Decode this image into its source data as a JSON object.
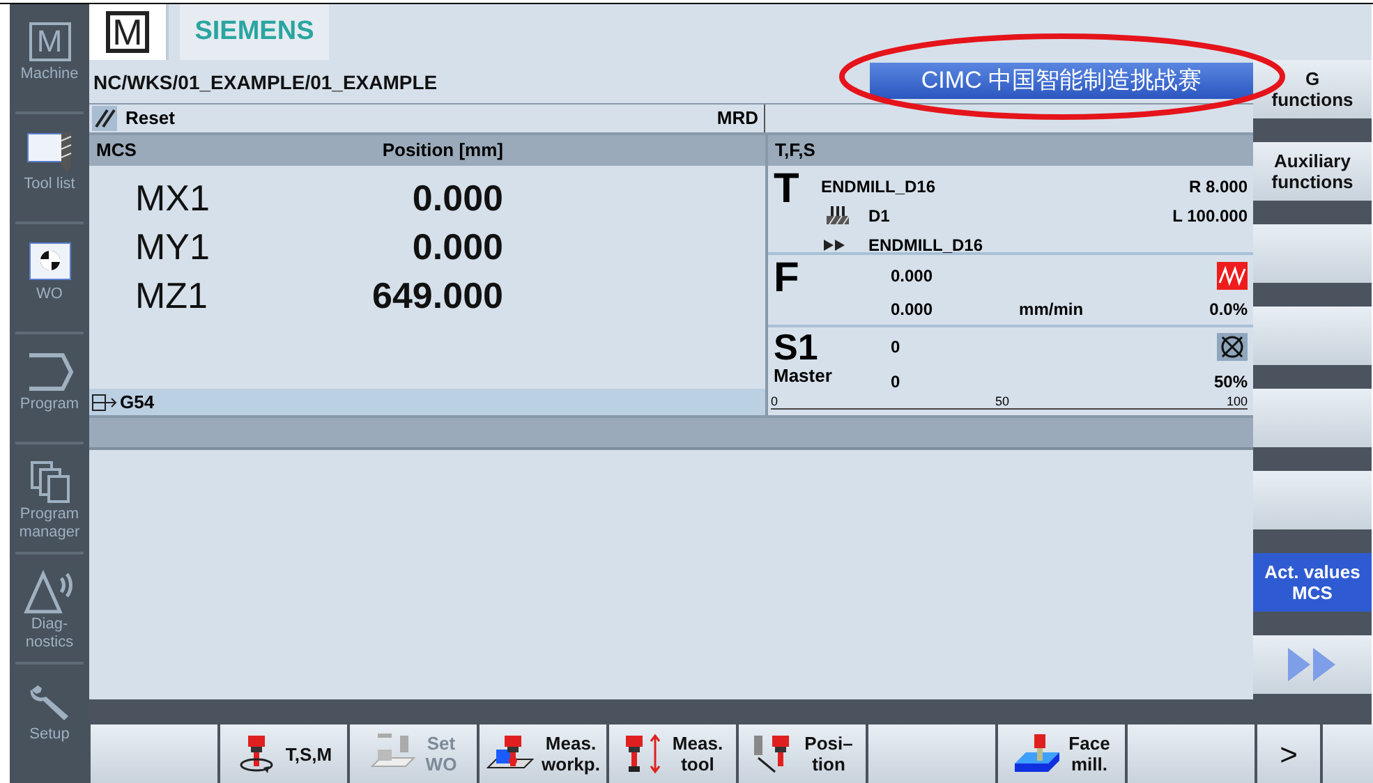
{
  "sidebar": {
    "items": [
      {
        "lines": [
          "Machine"
        ],
        "symbol": "M"
      },
      {
        "lines": [
          "Tool list"
        ]
      },
      {
        "lines": [
          "WO"
        ]
      },
      {
        "lines": [
          "Program"
        ]
      },
      {
        "lines": [
          "Program",
          "manager"
        ]
      },
      {
        "lines": [
          "Diag-",
          "nostics"
        ]
      },
      {
        "lines": [
          "Setup"
        ]
      }
    ]
  },
  "header": {
    "logo": "M",
    "brand": "SIEMENS",
    "banner": "CIMC 中国智能制造挑战赛"
  },
  "path": "NC/WKS/01_EXAMPLE/01_EXAMPLE",
  "status": {
    "channel": "Reset",
    "mode": "MRD"
  },
  "position_panel": {
    "columns": [
      "MCS",
      "Position [mm]"
    ],
    "rows": [
      {
        "axis": "MX1",
        "value": "0.000"
      },
      {
        "axis": "MY1",
        "value": "0.000"
      },
      {
        "axis": "MZ1",
        "value": "649.000"
      }
    ],
    "work_offset": "G54"
  },
  "tfs_panel": {
    "title": "T,F,S",
    "tool": {
      "letter": "T",
      "name": "ENDMILL_D16",
      "radius": "R 8.000",
      "edge": "D1",
      "length": "L 100.000",
      "next": "ENDMILL_D16"
    },
    "feed": {
      "letter": "F",
      "actual": "0.000",
      "setpoint": "0.000",
      "unit": "mm/min",
      "override": "0.0%",
      "disabled": true
    },
    "spindle": {
      "letter": "S1",
      "role": "Master",
      "actual": "0",
      "setpoint": "0",
      "override": "50%",
      "stopped": true,
      "scale": [
        "0",
        "50",
        "100"
      ]
    }
  },
  "right_softkeys": [
    {
      "kind": "text",
      "lines": [
        "G",
        "functions"
      ],
      "selected": false
    },
    {
      "kind": "text",
      "lines": [
        "Auxiliary",
        "functions"
      ],
      "selected": false
    },
    {
      "kind": "blank",
      "selected": false
    },
    {
      "kind": "blank",
      "selected": false
    },
    {
      "kind": "blank",
      "selected": false
    },
    {
      "kind": "blank",
      "selected": false
    },
    {
      "kind": "text",
      "lines": [
        "Act. values",
        "MCS"
      ],
      "selected": true
    },
    {
      "kind": "next",
      "selected": false
    }
  ],
  "bottom_softkeys": [
    {
      "kind": "blank"
    },
    {
      "kind": "text",
      "lines": [
        "T,S,M"
      ],
      "disabled": false
    },
    {
      "kind": "text",
      "lines": [
        "Set",
        "WO"
      ],
      "disabled": true
    },
    {
      "kind": "text",
      "lines": [
        "Meas.",
        "workp."
      ],
      "disabled": false
    },
    {
      "kind": "text",
      "lines": [
        "Meas.",
        "tool"
      ],
      "disabled": false
    },
    {
      "kind": "text",
      "lines": [
        "Posi–",
        "tion"
      ],
      "disabled": false
    },
    {
      "kind": "blank"
    },
    {
      "kind": "text",
      "lines": [
        "Face",
        "mill."
      ],
      "disabled": false
    },
    {
      "kind": "blank"
    },
    {
      "kind": "more",
      "label": ">",
      "disabled": false
    },
    {
      "kind": "blank"
    }
  ]
}
